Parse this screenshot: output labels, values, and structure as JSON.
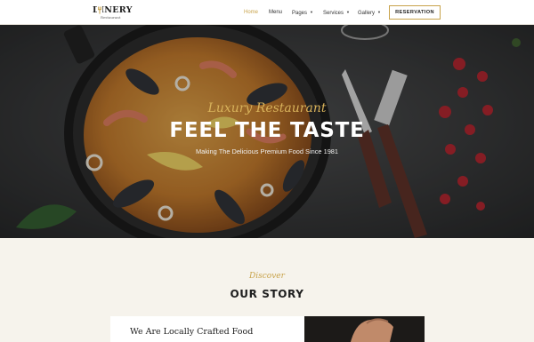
{
  "header": {
    "logo_name": "DINERY",
    "logo_sub": "Restaurant",
    "nav": [
      {
        "label": "Home",
        "active": true,
        "has_caret": false
      },
      {
        "label": "Menu",
        "active": false,
        "has_caret": false
      },
      {
        "label": "Pages",
        "active": false,
        "has_caret": true
      },
      {
        "label": "Services",
        "active": false,
        "has_caret": true
      },
      {
        "label": "Gallery",
        "active": false,
        "has_caret": true
      }
    ],
    "reservation_label": "RESERVATION"
  },
  "hero": {
    "script_text": "Luxury Restaurant",
    "title": "FEEL THE TASTE",
    "subtitle": "Making The Delicious Premium Food Since 1981"
  },
  "story": {
    "script_text": "Discover",
    "title": "OUR STORY",
    "card_heading": "We Are Locally Crafted Food"
  },
  "colors": {
    "accent": "#c8a34b",
    "dark": "#1e1e1e",
    "cream": "#f6f3ec"
  },
  "icons": [
    "logo-fork-icon",
    "caret-down-icon"
  ]
}
